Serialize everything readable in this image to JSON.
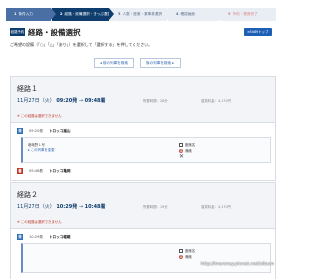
{
  "steps": [
    {
      "num": "1",
      "label": "条件入力"
    },
    {
      "num": "2",
      "label": "経路・設備選択・きっぷ選択"
    },
    {
      "num": "3",
      "label": "人数・座席・乗車券選択"
    },
    {
      "num": "4",
      "label": "確認画面"
    },
    {
      "num": "5",
      "label": "予約・発券完了"
    }
  ],
  "header": {
    "badge": "経路予約",
    "title": "経路・設備選択",
    "top_button": "e5489トップ"
  },
  "instruction": "ご希望の設備（「○」「△」「あり」）を選択して「選択する」を押してください。",
  "nav": {
    "prev": "前の列車を検索",
    "next": "後の列車を検索"
  },
  "routes": [
    {
      "name": "経路１",
      "date": "11月27日（火）",
      "dep_time": "09:20発",
      "arr_time": "09:48着",
      "duration": "所要時間：28分",
      "fare": "運賃料金：4,170円",
      "warning": "※ この経路は選択できません",
      "dep_station_time": "09:20発",
      "dep_station": "トロッコ嵐山",
      "train_label": "嵯峨野１号",
      "detail_link": "▸ この列車を変更",
      "seat_type": "座席名",
      "seat_status": "満席",
      "arr_station_time": "09:48着",
      "arr_station": "トロッコ亀岡"
    },
    {
      "name": "経路２",
      "date": "11月27日（火）",
      "dep_time": "10:29発",
      "arr_time": "10:48着",
      "duration": "所要時間：19分",
      "fare": "運賃料金：4,170円",
      "warning": "※ この経路は選択できません",
      "dep_station_time": "10:29発",
      "dep_station": "トロッコ嵯峨",
      "seat_type": "座席名",
      "seat_status": "満席"
    }
  ],
  "watermark": "http://marsray.pixnet.net/album"
}
